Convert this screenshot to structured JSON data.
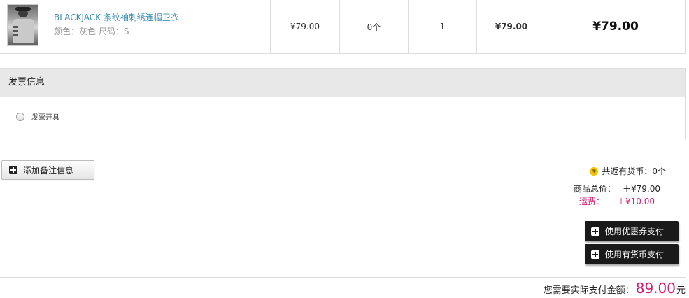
{
  "product": {
    "title": "BLACKJACK 条纹袖刺绣连帽卫衣",
    "attrs": "颜色：灰色  尺码：S",
    "price": "¥79.00",
    "coins": "0个",
    "quantity": "1",
    "subtotal": "¥79.00",
    "total": "¥79.00"
  },
  "invoice": {
    "heading": "发票信息",
    "option_label": "发票开具"
  },
  "remark": {
    "button_label": "添加备注信息"
  },
  "summary": {
    "coin_icon": "¥",
    "coins_return": "共返有货币：0个",
    "goods_label": "商品总价：",
    "goods_value": "＋¥79.00",
    "shipping_label": "运费：",
    "shipping_value": "＋¥10.00"
  },
  "actions": {
    "coupon_label": "使用优惠券支付",
    "coin_label": "使用有货币支付"
  },
  "payment": {
    "label": "您需要实际支付金额：",
    "amount": "89.00",
    "unit": "元"
  },
  "colors": {
    "link": "#3b8fb0",
    "accent": "#d6196e",
    "dark_button": "#1a1a1a",
    "section_bg": "#e8e8e8"
  }
}
